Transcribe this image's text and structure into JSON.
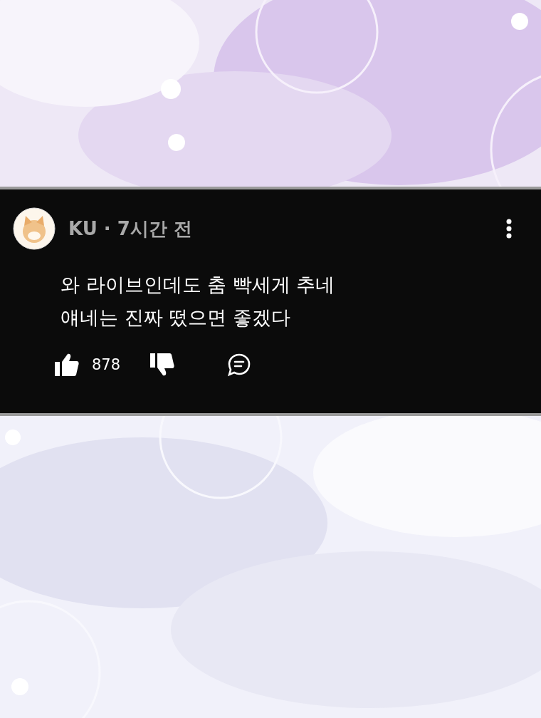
{
  "comment": {
    "byline": "KU · 7시간 전",
    "text": "와 라이브인데도 춤 빡세게 추네\n얘네는 진짜 떴으면 좋겠다",
    "likes": "878"
  }
}
